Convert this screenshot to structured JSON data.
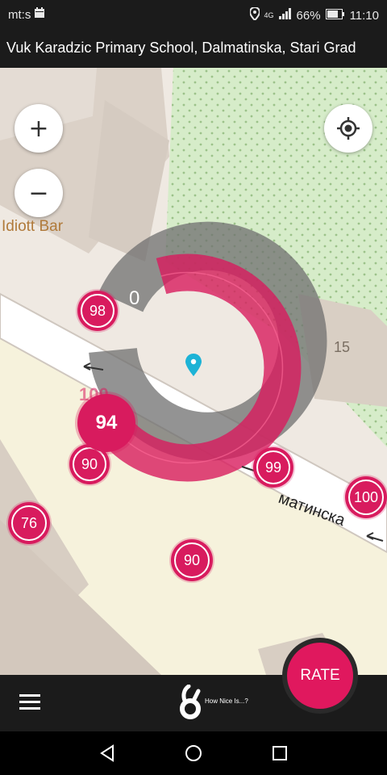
{
  "status": {
    "carrier": "mt:s",
    "network": "4G",
    "battery": "66%",
    "time": "11:10"
  },
  "title": "Vuk Karadzic  Primary School, Dalmatinska, Stari Grad",
  "map": {
    "zoom_in": "+",
    "zoom_out": "−",
    "poi_label": "Idiott Bar",
    "house_number": "15",
    "street_label": "матинска",
    "current_rating": "94",
    "ring_min": "0",
    "ring_max_ghost": "100",
    "markers": [
      "98",
      "90",
      "99",
      "100",
      "76",
      "90"
    ]
  },
  "bottom": {
    "rate_label": "RATE",
    "logo_text": "How Nice Is...?"
  },
  "colors": {
    "accent": "#d81b5e",
    "park": "#d6ecc9",
    "road": "#ffffff"
  }
}
